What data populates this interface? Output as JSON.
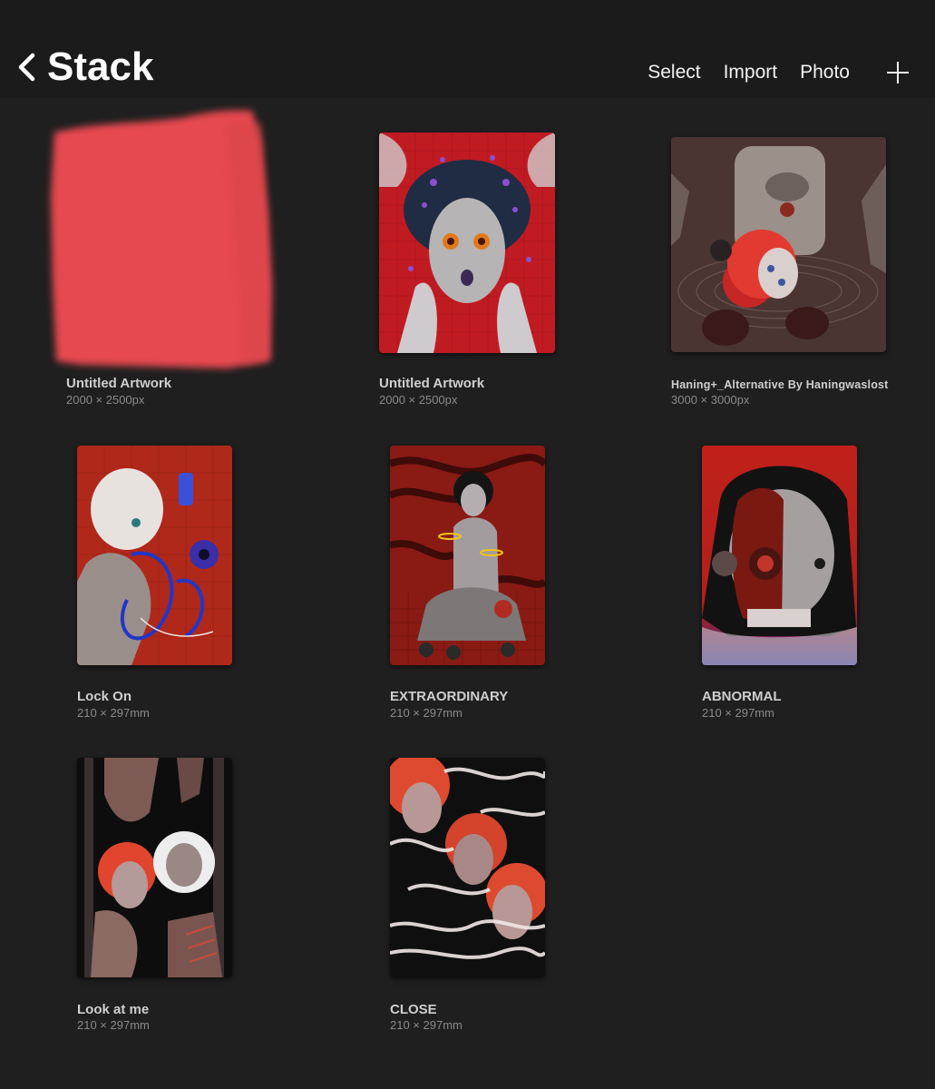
{
  "header": {
    "title": "Stack",
    "actions": [
      "Select",
      "Import",
      "Photo"
    ]
  },
  "artworks": [
    {
      "name": "Untitled Artwork",
      "dims": "2000 × 2500px"
    },
    {
      "name": "Untitled Artwork",
      "dims": "2000 × 2500px"
    },
    {
      "name": "Haning+_Alternative By Haningwaslost",
      "dims": "3000 × 3000px"
    },
    {
      "name": "Lock On",
      "dims": "210 × 297mm"
    },
    {
      "name": "EXTRAORDINARY",
      "dims": "210 × 297mm"
    },
    {
      "name": "ABNORMAL",
      "dims": "210 × 297mm"
    },
    {
      "name": "Look at me",
      "dims": "210 × 297mm"
    },
    {
      "name": "CLOSE",
      "dims": "210 × 297mm"
    }
  ],
  "colors": {
    "background": "#1f1f1f",
    "header": "#1b1b1b",
    "accent_red": "#e64a4f"
  },
  "icons": [
    "chevron-left-icon",
    "plus-icon"
  ]
}
